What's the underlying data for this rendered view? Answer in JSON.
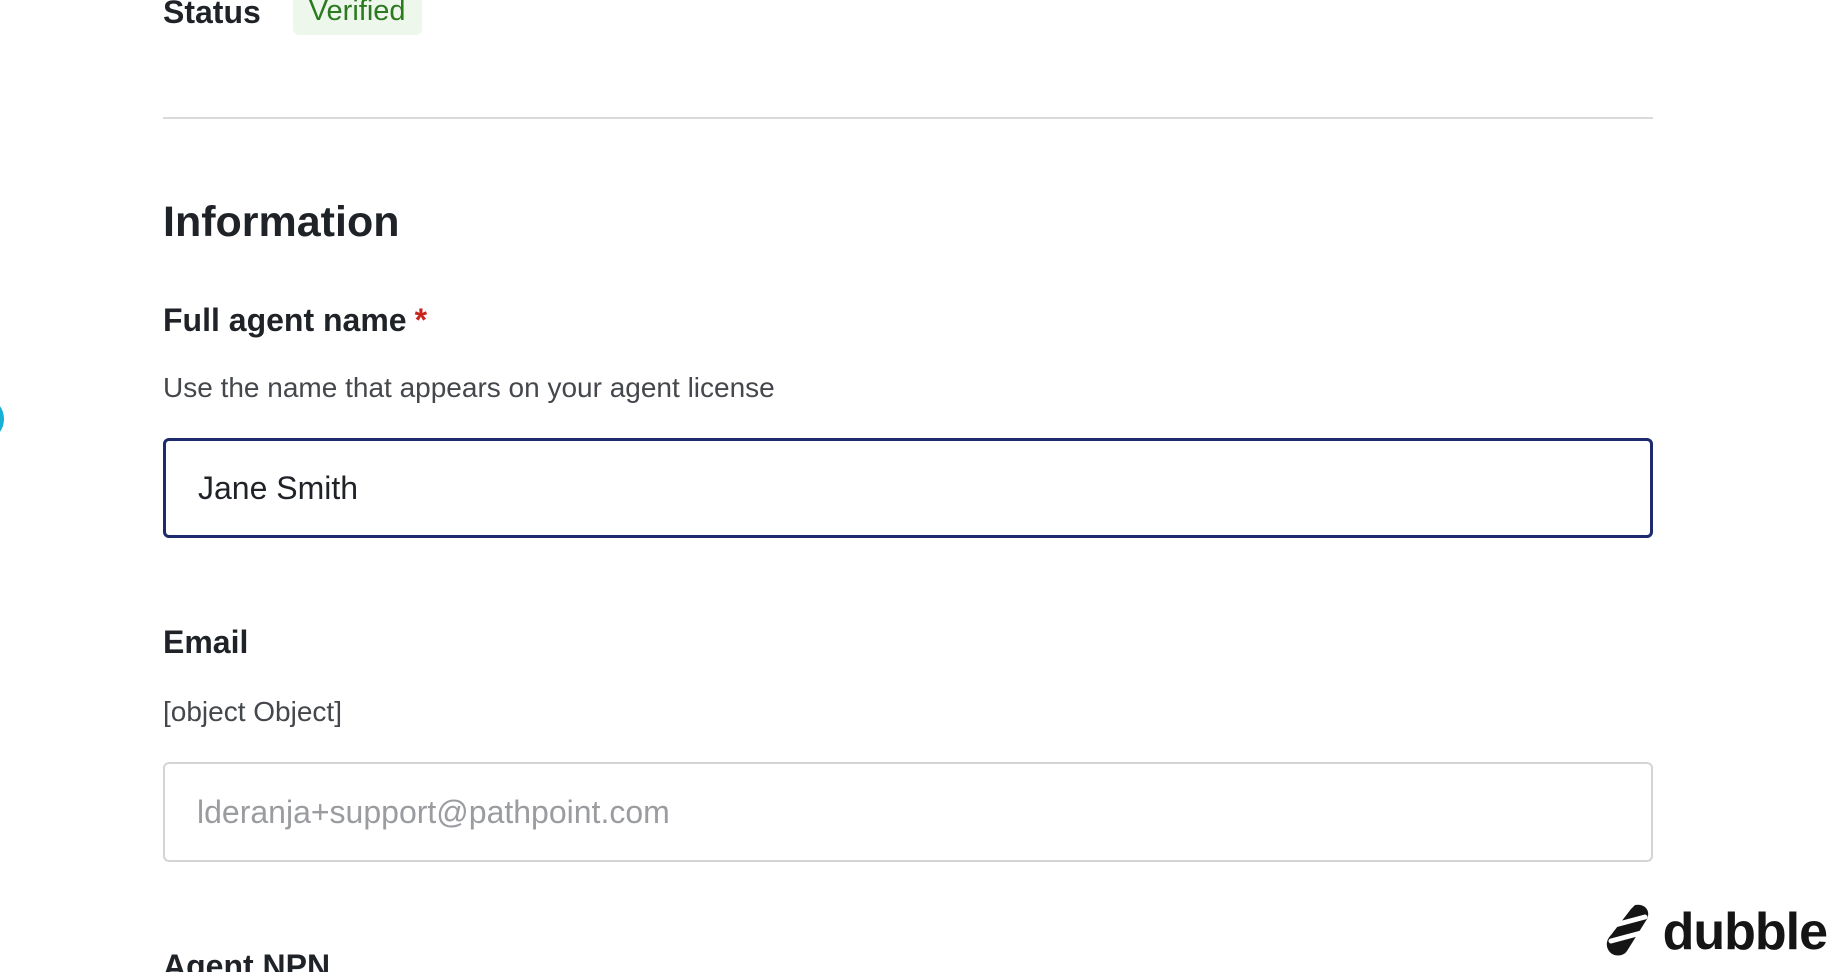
{
  "status": {
    "label": "Status",
    "badge": "Verified"
  },
  "information": {
    "title": "Information",
    "full_name": {
      "label": "Full agent name",
      "required_marker": "*",
      "help": "Use the name that appears on your agent license",
      "value": "Jane Smith"
    },
    "email": {
      "label": "Email",
      "help": "[object Object]",
      "placeholder": "lderanja+support@pathpoint.com",
      "value": ""
    },
    "agent_npn": {
      "label": "Agent NPN"
    }
  },
  "watermark": {
    "brand": "dubble",
    "icon": "dubble-logo-icon"
  },
  "colors": {
    "verified_text": "#2b7a1f",
    "verified_bg": "#eef7ec",
    "focus_border": "#1d2a6e",
    "required": "#c8241b",
    "cursor": "#17b0d6"
  }
}
